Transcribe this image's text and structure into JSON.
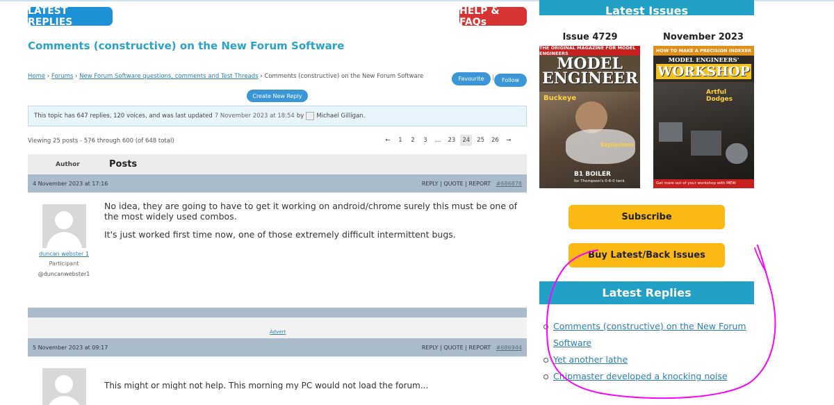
{
  "header": {
    "latest_replies_label": "LATEST REPLIES",
    "help_label": "HELP & FAQs"
  },
  "topic": {
    "title": "Comments (constructive) on the New Forum Software",
    "breadcrumb": {
      "home": "Home",
      "forums": "Forums",
      "forum": "New Forum Software questions, comments and Test Threads",
      "current": "Comments (constructive) on the New Forum Software",
      "separator": "›"
    },
    "favourite_label": "Favourite",
    "follow_label": "Follow",
    "create_reply_label": "Create New Reply",
    "notice": {
      "text": "This topic has 647 replies, 120 voices, and was last updated",
      "updated": "7 November 2023 at 18:54",
      "by": "by",
      "user": "Michael Gilligan."
    },
    "viewing": "Viewing 25 posts - 576 through 600 (of 648 total)",
    "pagination": [
      "←",
      "1",
      "2",
      "3",
      "…",
      "23",
      "24",
      "25",
      "26",
      "→"
    ],
    "current_page": "24"
  },
  "posts_table": {
    "author_header": "Author",
    "posts_header": "Posts",
    "posts": [
      {
        "date": "4 November 2023 at 17:16",
        "actions": "REPLY | QUOTE | REPORT",
        "id": "#686878",
        "author_name": "duncan webster 1",
        "author_role": "Participant",
        "author_handle": "@duncanwebster1",
        "paragraphs": [
          "No idea, they are going to have to get it working on android/chrome surely this must be one of the most widely used combos.",
          "It's just worked first time now, one of those extremely difficult intermittent bugs."
        ]
      },
      {
        "date": "5 November 2023 at 09:17",
        "actions": "REPLY | QUOTE | REPORT",
        "id": "#686944",
        "preview": "This might or might not help. This morning my PC would not load the forum..."
      }
    ],
    "advert_label": "Advert"
  },
  "sidebar": {
    "latest_issues_title": "Latest Issues",
    "magazines": [
      {
        "label": "Issue 4729",
        "masthead": "MODEL ENGINEER",
        "banner": "THE ORIGINAL MAGAZINE FOR MODEL ENGINEERS",
        "headline1": "Buckeye",
        "headline2": "B1 BOILER",
        "headline3": "for Thompson's 0-6-0 tank",
        "headline4": "Explosions"
      },
      {
        "label": "November 2023",
        "masthead": "WORKSHOP",
        "masthead_top": "MODEL ENGINEERS'",
        "banner": "HOW TO MAKE A PRECISION INDEXER",
        "headline1": "Artful Dodges",
        "headline2": "Get more out of your workshop with MEW"
      }
    ],
    "subscribe_label": "Subscribe",
    "buy_label": "Buy Latest/Back Issues",
    "latest_replies_title": "Latest Replies",
    "latest_replies": [
      "Comments (constructive) on the New Forum Software",
      "Yet another lathe",
      "Chipmaster developed a knocking noise"
    ]
  },
  "colors": {
    "accent_blue": "#22a0c6",
    "link": "#2a7fb8",
    "help_red": "#d63333",
    "subscribe_yellow": "#fdb913",
    "annotation_magenta": "#ff00ff"
  }
}
